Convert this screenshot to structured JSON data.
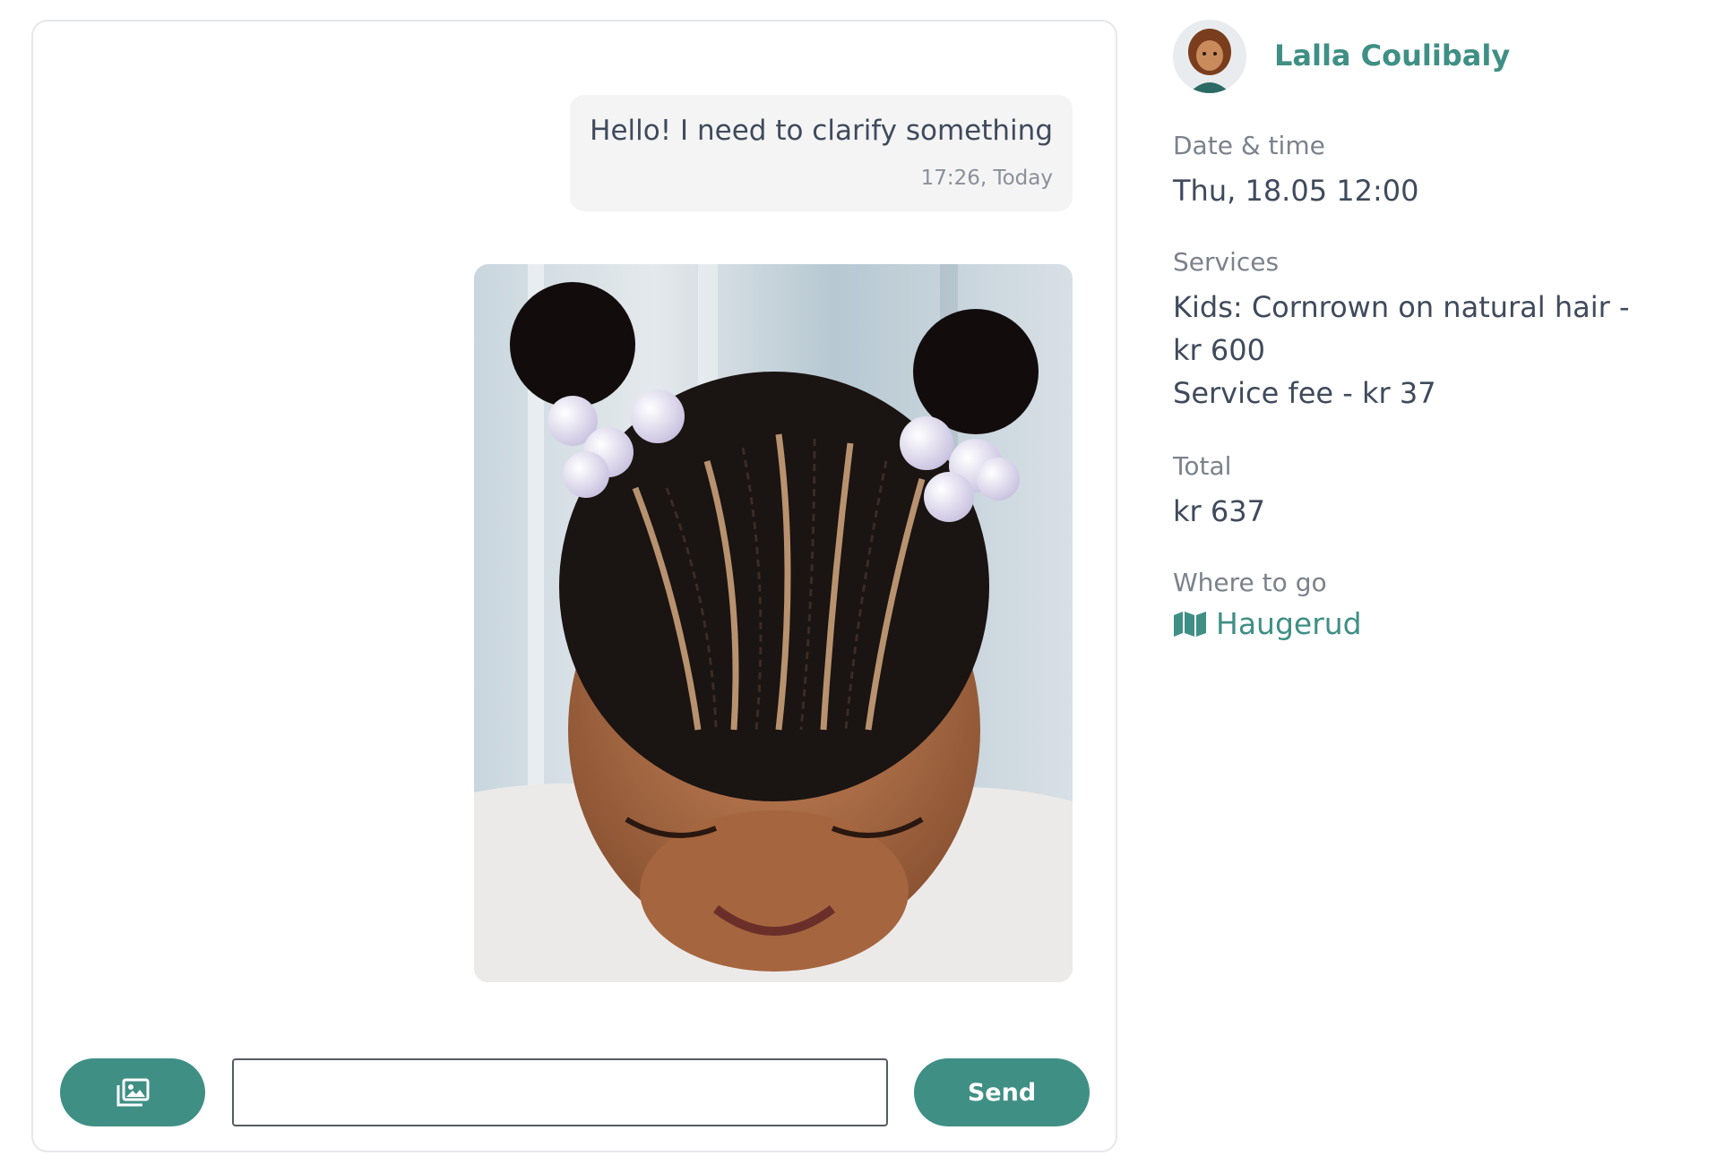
{
  "conversation": {
    "messages": [
      {
        "text": "Hello! I need to clarify something",
        "time": "17:26, Today"
      }
    ],
    "attachment_image": "child-cornrows-photo"
  },
  "composer": {
    "attach_icon": "image-gallery-icon",
    "input_value": "",
    "input_placeholder": "",
    "send_label": "Send"
  },
  "profile": {
    "name": "Lalla Coulibaly",
    "avatar_icon": "user-avatar-icon"
  },
  "booking": {
    "date_label": "Date & time",
    "date_value": "Thu, 18.05 12:00",
    "services_label": "Services",
    "services": [
      "Kids: Cornrown on natural hair -",
      "kr 600",
      "Service fee - kr 37"
    ],
    "total_label": "Total",
    "total_value": "kr 637",
    "location_label": "Where to go",
    "location_value": "Haugerud",
    "location_icon": "map-icon"
  },
  "colors": {
    "accent": "#3f8f85",
    "text": "#3f4a5c",
    "muted": "#7b828c",
    "bubble": "#f4f4f5"
  }
}
